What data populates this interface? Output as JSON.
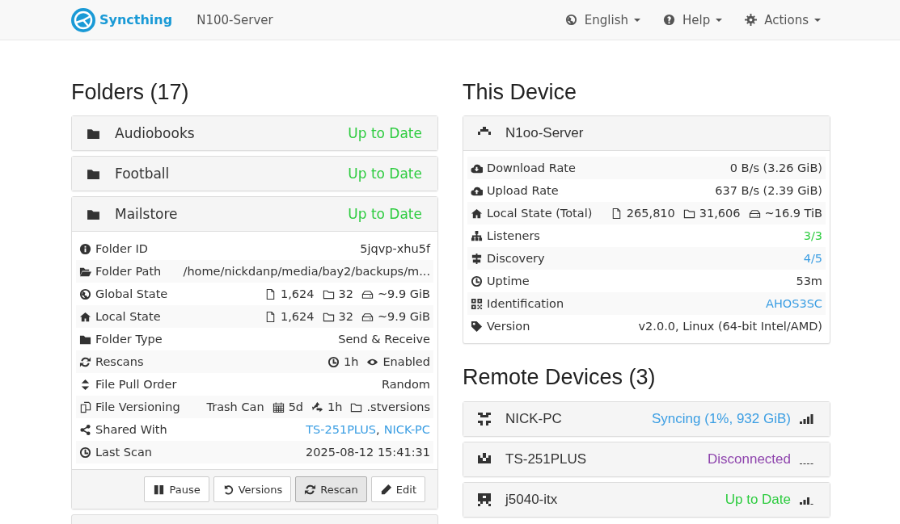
{
  "navbar": {
    "brand": "Syncthing",
    "device_name": "N100-Server",
    "menus": [
      {
        "kind": "language",
        "label": "English"
      },
      {
        "kind": "help",
        "label": "Help"
      },
      {
        "kind": "actions",
        "label": "Actions"
      }
    ]
  },
  "folders_heading": "Folders (17)",
  "folders": [
    {
      "name": "Audiobooks",
      "color": "#2ecc40",
      "status": "Up to Date",
      "expanded": false
    },
    {
      "name": "Football",
      "color": "#2ecc40",
      "status": "Up to Date",
      "expanded": false
    },
    {
      "name": "Mailstore",
      "color": "#2ecc40",
      "status": "Up to Date",
      "expanded": true,
      "details": [
        {
          "kind": "id",
          "label": "Folder ID",
          "value": "5jqvp-xhu5f"
        },
        {
          "kind": "path",
          "label": "Folder Path",
          "value": "/home/nickdanp/media/bay2/backups/m..."
        },
        {
          "kind": "global",
          "label": "Global State",
          "files": "1,624",
          "dirs": "32",
          "size": "~9.9 GiB"
        },
        {
          "kind": "local",
          "label": "Local State",
          "files": "1,624",
          "dirs": "32",
          "size": "~9.9 GiB"
        },
        {
          "kind": "type",
          "label": "Folder Type",
          "value": "Send & Receive"
        },
        {
          "kind": "rescans",
          "label": "Rescans",
          "interval": "1h",
          "watcher": "Enabled"
        },
        {
          "kind": "pull",
          "label": "File Pull Order",
          "value": "Random"
        },
        {
          "kind": "versioning",
          "label": "File Versioning",
          "type": "Trash Can",
          "keep": "5d",
          "cleanup": "1h",
          "path": ".stversions"
        },
        {
          "kind": "shared",
          "label": "Shared With",
          "devices": [
            "TS-251PLUS",
            "NICK-PC"
          ],
          "separator": ","
        },
        {
          "kind": "scan",
          "label": "Last Scan",
          "value": "2025-08-12 15:41:31"
        }
      ],
      "buttons": [
        {
          "kind": "pause",
          "label": "Pause",
          "hovered": false
        },
        {
          "kind": "versions",
          "label": "Versions",
          "hovered": false
        },
        {
          "kind": "rescan",
          "label": "Rescan",
          "hovered": true
        },
        {
          "kind": "edit",
          "label": "Edit",
          "hovered": false
        }
      ]
    }
  ],
  "this_device_heading": "This Device",
  "this_device": {
    "name": "N1oo-Server",
    "rows": [
      {
        "kind": "download",
        "label": "Download Rate",
        "value": "0 B/s (3.26 GiB)"
      },
      {
        "kind": "upload",
        "label": "Upload Rate",
        "value": "637 B/s (2.39 GiB)"
      },
      {
        "kind": "local",
        "label": "Local State (Total)",
        "files": "265,810",
        "dirs": "31,606",
        "size": "~16.9 TiB"
      },
      {
        "kind": "listeners",
        "label": "Listeners",
        "value": "3/3"
      },
      {
        "kind": "discovery",
        "label": "Discovery",
        "value": "4/5"
      },
      {
        "kind": "uptime",
        "label": "Uptime",
        "value": "53m"
      },
      {
        "kind": "identification",
        "label": "Identification",
        "value": "AHOS3SC"
      },
      {
        "kind": "version",
        "label": "Version",
        "value": "v2.0.0, Linux (64-bit Intel/AMD)"
      }
    ]
  },
  "remote_heading": "Remote Devices (3)",
  "remote_devices": [
    {
      "kind": "strong",
      "name": "NICK-PC",
      "color": "#3b9ee3",
      "status": "Syncing (1%, 932 GiB)"
    },
    {
      "kind": "offline",
      "name": "TS-251PLUS",
      "color": "#8e44ad",
      "status": "Disconnected"
    },
    {
      "kind": "medium",
      "name": "j5040-itx",
      "color": "#2ecc40",
      "status": "Up to Date"
    }
  ]
}
